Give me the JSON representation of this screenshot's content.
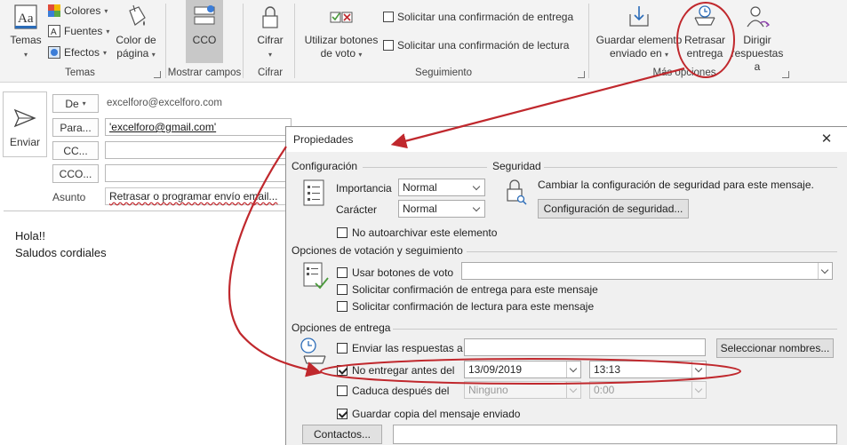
{
  "ribbon": {
    "temas_label": "Temas",
    "colores_label": "Colores",
    "fuentes_label": "Fuentes",
    "efectos_label": "Efectos",
    "color_pagina_line1": "Color de",
    "color_pagina_line2": "página",
    "group_temas": "Temas",
    "cco_label": "CCO",
    "group_mostrar": "Mostrar campos",
    "cifrar_label": "Cifrar",
    "group_cifrar": "Cifrar",
    "utilizar_line1": "Utilizar botones",
    "utilizar_line2": "de voto",
    "solicitar_entrega": "Solicitar una confirmación de entrega",
    "solicitar_lectura": "Solicitar una confirmación de lectura",
    "group_seguimiento": "Seguimiento",
    "guardar_line1": "Guardar elemento",
    "guardar_line2": "enviado en",
    "retrasar_line1": "Retrasar",
    "retrasar_line2": "entrega",
    "dirigir_line1": "Dirigir",
    "dirigir_line2": "respuestas a",
    "group_mas": "Más opciones"
  },
  "compose": {
    "send_label": "Enviar",
    "de_label": "De",
    "from_address": "excelforo@excelforo.com",
    "para_label": "Para...",
    "to_value": "'excelforo@gmail.com'",
    "cc_label": "CC...",
    "cco_label": "CCO...",
    "asunto_label": "Asunto",
    "subject_value": "Retrasar o programar envío email...",
    "body_line1": "Hola!!",
    "body_line2": "Saludos cordiales"
  },
  "dialog": {
    "title": "Propiedades",
    "configuracion_title": "Configuración",
    "importancia_label": "Importancia",
    "importancia_value": "Normal",
    "caracter_label": "Carácter",
    "caracter_value": "Normal",
    "no_autoarchivar": "No autoarchivar este elemento",
    "seguridad_title": "Seguridad",
    "seguridad_text": "Cambiar la configuración de seguridad para este mensaje.",
    "config_seguridad_button": "Configuración de seguridad...",
    "votacion_title": "Opciones de votación y seguimiento",
    "usar_botones": "Usar botones de voto",
    "solicitar_entrega": "Solicitar confirmación de entrega para este mensaje",
    "solicitar_lectura": "Solicitar confirmación de lectura para este mensaje",
    "entrega_title": "Opciones de entrega",
    "enviar_respuestas": "Enviar las respuestas a",
    "seleccionar_nombres": "Seleccionar nombres...",
    "no_entregar": "No entregar antes del",
    "no_entregar_date": "13/09/2019",
    "no_entregar_time": "13:13",
    "caduca": "Caduca después del",
    "caduca_date": "Ninguno",
    "caduca_time": "0:00",
    "guardar_copia": "Guardar copia del mensaje enviado",
    "contactos_button": "Contactos..."
  },
  "colors": {
    "annotation_red": "#c0282d",
    "ribbon_bg": "#f3f3f3",
    "dialog_bg": "#f0f0f0"
  }
}
